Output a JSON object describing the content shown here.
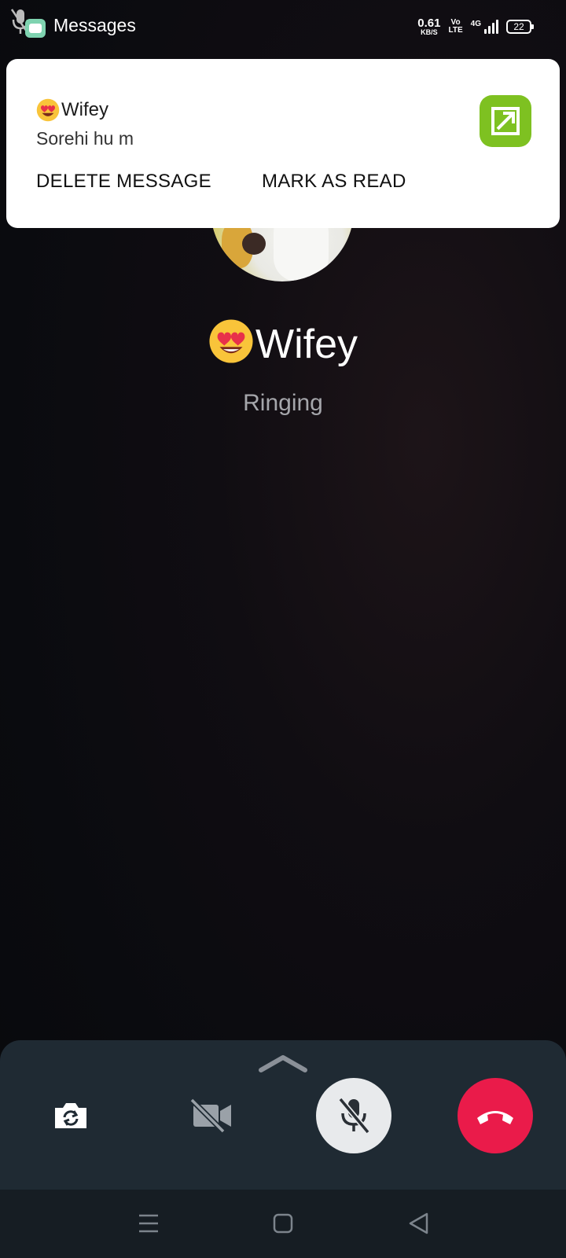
{
  "status_bar": {
    "app_title": "Messages",
    "net_speed_value": "0.61",
    "net_speed_unit": "KB/S",
    "volte_top": "Vo",
    "volte_bottom": "LTE",
    "network_type": "4G",
    "battery_level": "22"
  },
  "notification": {
    "sender": "Wifey",
    "message": "Sorehi hu m",
    "actions": [
      "DELETE MESSAGE",
      "MARK AS READ"
    ],
    "app_icon_color": "#7ec121"
  },
  "call": {
    "contact_name": "Wifey",
    "status": "Ringing"
  },
  "controls": {
    "icons": [
      "flip-camera-icon",
      "video-off-icon",
      "mic-off-icon",
      "end-call-icon"
    ],
    "mute_bg": "#e8eaec",
    "end_bg": "#ea1b4a"
  },
  "nav": {
    "icons": [
      "menu-icon",
      "home-icon",
      "back-icon"
    ]
  }
}
